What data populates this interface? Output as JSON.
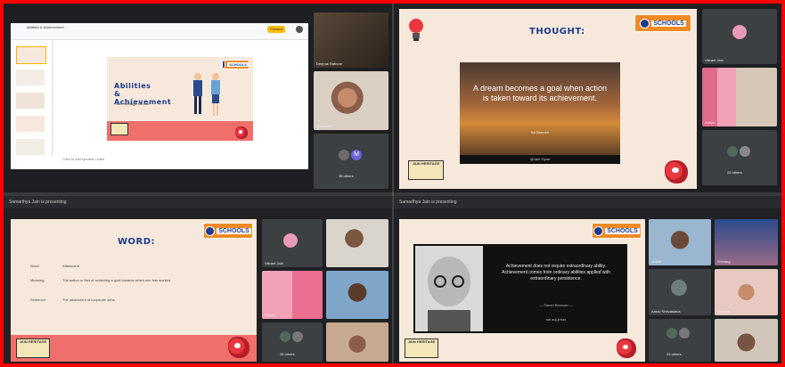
{
  "q1": {
    "doc_title": "Abilities & Achievement",
    "slide_title": "Abilities & Achievement",
    "slide_subtitle": "Jain Heritage School",
    "speaker_notes": "Click to add speaker notes",
    "present_label": "Present",
    "tiles": [
      "Deepak Rathore",
      "Shivanshi",
      "26 others"
    ]
  },
  "q2": {
    "title": "THOUGHT:",
    "quote": "A dream becomes a goal when action is taken toward its achievement.",
    "quote_author": "Bo Bennett",
    "caption": "@Jain Gyan",
    "logo_text": "SCHOOLS",
    "stamp": "JAIN HERITAGE",
    "tiles": [
      "Vikrant Jain",
      "Aditya",
      "25 others"
    ]
  },
  "q3": {
    "presenting": "Samarthya Jain is presenting",
    "title": "WORD:",
    "rows": [
      {
        "k": "Word:",
        "v": "Attainment"
      },
      {
        "k": "Meaning:",
        "v": "The action or fact of achieving a goal towards which one has worked."
      },
      {
        "k": "Sentence:",
        "v": "The attainment of corporate aims."
      }
    ],
    "logo_text": "SCHOOLS",
    "stamp": "JAIN HERITAGE",
    "tiles": [
      "Vikrant Jain",
      "",
      "Rohan",
      "",
      "26 others",
      ""
    ]
  },
  "q4": {
    "presenting": "Samarthya Jain is presenting",
    "quote": "Achievement does not require extraordinary ability. Achievement comes from ordinary abilities applied with extraordinary persistence.",
    "author": "— Simon Brennan —",
    "caption": "aai auj jerlas",
    "logo_text": "SCHOOLS",
    "stamp": "JAIN HERITAGE",
    "tiles": [
      "Aniket",
      "Shivang",
      "Aarav Shrivastava",
      "Tanisha",
      "25 others",
      ""
    ]
  },
  "colors": {
    "frame": "#ff0000",
    "accent": "#f08a24",
    "navy": "#1b3b8c",
    "slide_bg": "#f6e9dc",
    "salmon": "#ef6f6a"
  }
}
